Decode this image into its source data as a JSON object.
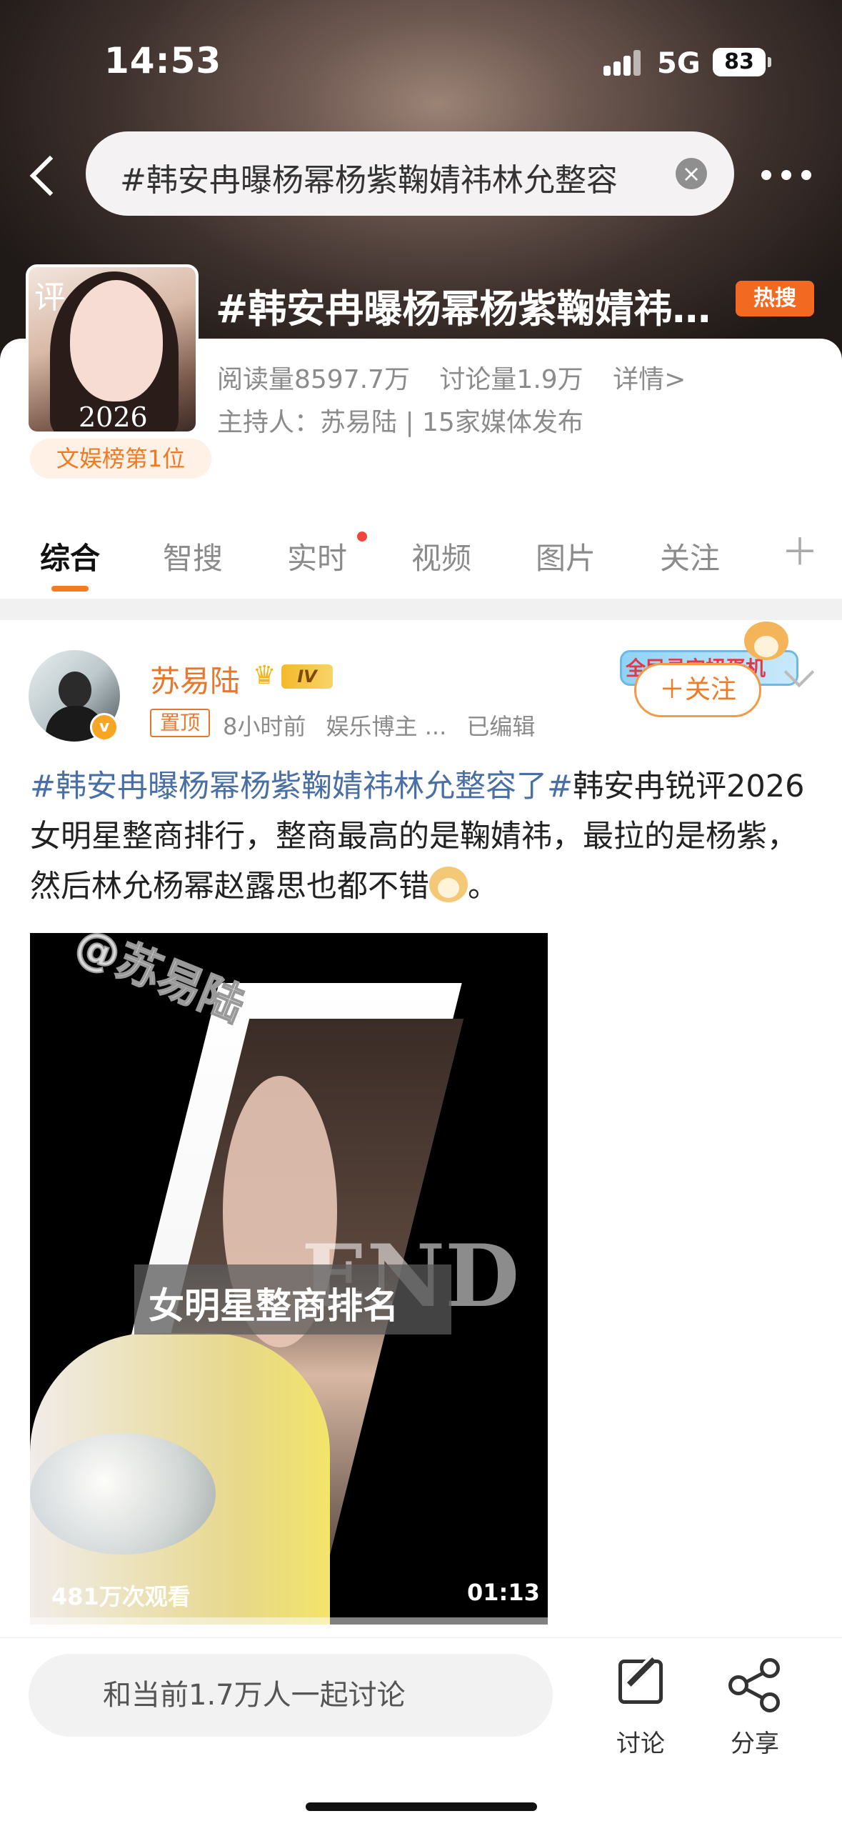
{
  "status_bar": {
    "time": "14:53",
    "network": "5G",
    "battery": "83"
  },
  "header": {
    "search_text": "#韩安冉曝杨幂杨紫鞠婧祎林允整容了#",
    "topic_title": "#韩安冉曝杨幂杨紫鞠婧祎林允整容了#",
    "hot_badge": "热搜"
  },
  "topic_info": {
    "cover_char": "评",
    "cover_year": "2026",
    "rank": "文娱榜第1位",
    "reads": "阅读量8597.7万",
    "discussions": "讨论量1.9万",
    "details": "详情>",
    "host": "主持人：苏易陆 | 15家媒体发布"
  },
  "tabs": [
    {
      "label": "综合",
      "active": true
    },
    {
      "label": "智搜"
    },
    {
      "label": "实时",
      "dot": true
    },
    {
      "label": "视频"
    },
    {
      "label": "图片"
    },
    {
      "label": "关注"
    }
  ],
  "post": {
    "author": "苏易陆",
    "level": "IV",
    "pinned": "置顶",
    "time": "8小时前",
    "category": "娱乐博主 ...",
    "edited": "已编辑",
    "follow": "＋关注",
    "deco_text": "全民寻宝扭蛋机",
    "hashtag": "#韩安冉曝杨幂杨紫鞠婧祎林允整容了#",
    "body": "韩安冉锐评2026女明星整商排行，整商最高的是鞠婧祎，最拉的是杨紫，然后林允杨幂赵露思也都不错",
    "tail": "。"
  },
  "video": {
    "watermark": "@苏易陆",
    "caption": "女明星整商排名",
    "end_text": "END",
    "views": "481万次观看",
    "duration": "01:13",
    "progress": 0.0
  },
  "bottom": {
    "discuss_placeholder": "和当前1.7万人一起讨论",
    "discuss_label": "讨论",
    "share_label": "分享"
  }
}
